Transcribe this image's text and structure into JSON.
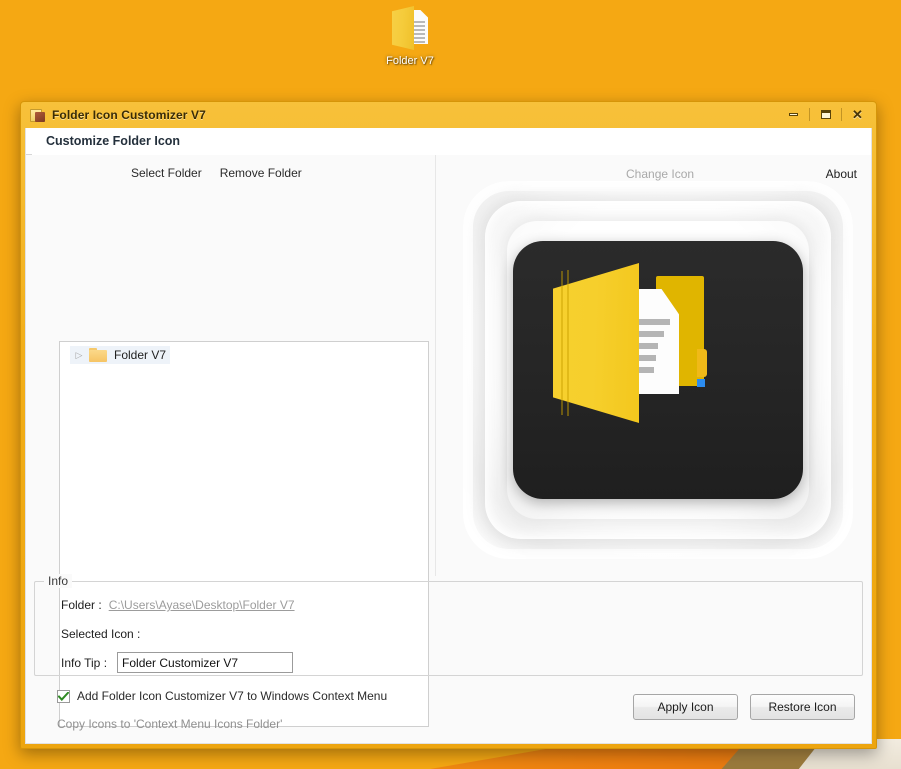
{
  "desktop": {
    "icon": {
      "name": "folder-v7-shortcut",
      "label": "Folder V7"
    },
    "background_color": "#f5a813"
  },
  "window": {
    "title": "Folder Icon Customizer V7",
    "icon_name": "app-folder-icon",
    "controls": {
      "minimize": "Minimize",
      "maximize": "Maximize",
      "close": "Close",
      "close_glyph": "✕"
    }
  },
  "tabs": [
    {
      "label": "Customize Folder Icon",
      "active": true
    }
  ],
  "left_panel": {
    "toolbar": {
      "select_folder": "Select Folder",
      "remove_folder": "Remove Folder"
    },
    "tree": {
      "expander_glyph": "▷",
      "items": [
        {
          "label": "Folder V7",
          "icon": "folder-icon",
          "selected": true
        }
      ]
    }
  },
  "right_panel": {
    "toolbar": {
      "change_icon": "Change Icon",
      "change_icon_enabled": false,
      "about": "About"
    },
    "preview": {
      "name": "folder-document-icon-preview",
      "tile_color": "#252525",
      "folder_color": "#f4ce2a",
      "document_color": "#fdfdfd",
      "accent_blue": "#2b8cf0"
    }
  },
  "info": {
    "legend": "Info",
    "folder_label": "Folder :",
    "folder_path": "C:\\Users\\Ayase\\Desktop\\Folder V7",
    "selected_icon_label": "Selected Icon :",
    "selected_icon_value": "",
    "info_tip_label": "Info Tip :",
    "info_tip_value": "Folder Customizer V7",
    "info_tip_placeholder": ""
  },
  "footer": {
    "context_menu_checkbox_label": "Add Folder Icon Customizer V7  to Windows Context Menu",
    "context_menu_checked": true,
    "copy_icons_label": "Copy Icons to 'Context Menu Icons Folder'",
    "apply_button": "Apply Icon",
    "restore_button": "Restore Icon"
  }
}
